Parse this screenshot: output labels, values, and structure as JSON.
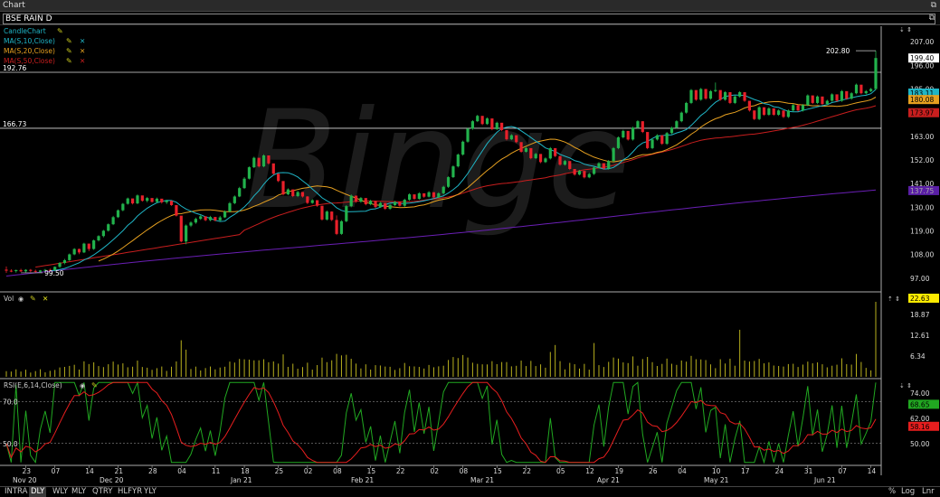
{
  "window": {
    "title": "Chart"
  },
  "symbol": "BSE RAIN D",
  "indicators": {
    "candle": "CandleChart",
    "ma10": "MA(S,10,Close)",
    "ma20": "MA(S,20,Close)",
    "ma50": "MA(S,50,Close)",
    "vol": "Vol",
    "rsi": "RSI(E,6,14,Close)"
  },
  "colors": {
    "up": "#22b24c",
    "down": "#e8202a",
    "ma10": "#1fb5c6",
    "ma20": "#e6a020",
    "ma50": "#c81e1e",
    "ma200": "#6a1fb5",
    "vol": "#b8b01e",
    "rsi": "#21a821",
    "rsisig": "#e61e1e"
  },
  "price_axis": {
    "ticks": [
      "207.00",
      "196.00",
      "185.00",
      "174.00",
      "163.00",
      "152.00",
      "141.00",
      "130.00",
      "119.00",
      "108.00",
      "97.00"
    ]
  },
  "badges": {
    "last": "199.40",
    "ma10": "183.11",
    "ma20": "180.08",
    "ma50": "173.97",
    "ma200": "137.75",
    "vol": "22.63",
    "rsi_a": "68.65",
    "rsi_b": "58.16"
  },
  "annotations": {
    "high": "202.80",
    "low": "99.50",
    "hline1": "192.76",
    "hline2": "166.73"
  },
  "vol_axis": {
    "ticks": [
      "18.87",
      "12.61",
      "6.34"
    ]
  },
  "rsi_axis": {
    "ticks": [
      "74.00",
      "62.00",
      "50.00"
    ],
    "left_70": "70.0",
    "left_50": "50.0"
  },
  "date_axis": {
    "days": [
      "23",
      "07",
      "14",
      "21",
      "28",
      "04",
      "11",
      "18",
      "25",
      "02",
      "08",
      "15",
      "22",
      "02",
      "08",
      "15",
      "22",
      "05",
      "12",
      "19",
      "26",
      "04",
      "10",
      "17",
      "24",
      "31",
      "07",
      "14"
    ],
    "months": [
      "Nov 20",
      "Dec 20",
      "Jan 21",
      "Feb 21",
      "Mar 21",
      "Apr 21",
      "May 21",
      "Jun 21"
    ]
  },
  "periods": [
    "INTRA",
    "DLY",
    "WLY",
    "MLY",
    "QTRY",
    "HLFYR",
    "YLY"
  ],
  "active_period": "DLY",
  "scale_buttons": [
    "%",
    "Log",
    "Lnr"
  ],
  "watermark": "Binge",
  "chart_data": {
    "type": "candlestick",
    "ohlc_approx": [
      [
        101,
        102.5,
        99.5,
        100.5
      ],
      [
        100.5,
        101.2,
        99.8,
        100.3
      ],
      [
        100.3,
        101,
        99.6,
        100.8
      ],
      [
        100.8,
        101.4,
        99.9,
        100.2
      ],
      [
        100.2,
        101.2,
        99.7,
        100.9
      ],
      [
        100.9,
        101.3,
        99.8,
        100.4
      ],
      [
        100.4,
        101,
        99.5,
        100
      ],
      [
        100,
        100.8,
        99.5,
        100.6
      ],
      [
        100.6,
        101.3,
        100.1,
        100.9
      ],
      [
        100.9,
        101.5,
        100.2,
        100.7
      ],
      [
        100.7,
        102.5,
        100.3,
        102.3
      ],
      [
        102.3,
        104.5,
        101.8,
        104.1
      ],
      [
        104.1,
        106,
        103.5,
        105.4
      ],
      [
        105.4,
        108.5,
        105,
        108.1
      ],
      [
        108.1,
        111,
        107.7,
        110.6
      ],
      [
        110.6,
        110.8,
        108.2,
        109
      ],
      [
        109,
        113.5,
        108.7,
        113.1
      ],
      [
        113.1,
        112.8,
        109.6,
        110.6
      ],
      [
        110.6,
        115,
        110.2,
        114.6
      ],
      [
        114.6,
        117,
        114.1,
        116.6
      ],
      [
        116.6,
        119.5,
        116,
        119.1
      ],
      [
        119.1,
        122.5,
        118.7,
        122.1
      ],
      [
        122.1,
        126,
        121.7,
        125.4
      ],
      [
        125.4,
        129,
        125,
        128.6
      ],
      [
        128.6,
        132,
        128.1,
        131.6
      ],
      [
        131.6,
        134.5,
        131.2,
        134.1
      ],
      [
        134.1,
        133.8,
        131.3,
        131.8
      ],
      [
        131.8,
        136,
        131.4,
        135.5
      ],
      [
        135.5,
        135.3,
        132.6,
        133
      ],
      [
        133,
        134.8,
        132.3,
        134.3
      ],
      [
        134.3,
        134.1,
        132.2,
        132.5
      ],
      [
        132.5,
        134.5,
        132,
        134
      ],
      [
        134,
        133.8,
        131.7,
        132.3
      ],
      [
        132.3,
        133.5,
        131.5,
        133
      ],
      [
        133,
        132.8,
        130.6,
        131
      ],
      [
        131,
        130.6,
        125.7,
        126.1
      ],
      [
        126.1,
        125.8,
        113.7,
        114.1
      ],
      [
        114.1,
        122,
        112.8,
        121.5
      ],
      [
        121.5,
        123.5,
        120.8,
        122.9
      ],
      [
        122.9,
        125.2,
        122.3,
        124.6
      ],
      [
        124.6,
        126.5,
        124.1,
        125.8
      ],
      [
        125.8,
        125.5,
        123.5,
        124
      ],
      [
        124,
        126,
        123.5,
        125.5
      ],
      [
        125.5,
        125.3,
        123.4,
        123.9
      ],
      [
        123.9,
        126,
        123.5,
        125.3
      ],
      [
        125.3,
        128.5,
        125,
        128
      ],
      [
        128,
        132.5,
        127.6,
        131.9
      ],
      [
        131.9,
        135.5,
        131.4,
        135
      ],
      [
        135,
        139.5,
        134.7,
        138.9
      ],
      [
        138.9,
        144,
        138.5,
        143.3
      ],
      [
        143.3,
        149,
        142.9,
        148.6
      ],
      [
        148.6,
        153.5,
        148.2,
        153
      ],
      [
        153,
        152.8,
        148.5,
        149
      ],
      [
        149,
        154.6,
        148.6,
        154.1
      ],
      [
        154.1,
        153.6,
        149.9,
        150.4
      ],
      [
        150.4,
        150.2,
        145.1,
        145.6
      ],
      [
        145.6,
        145.4,
        141.7,
        142.2
      ],
      [
        142.2,
        141.9,
        135.5,
        136
      ],
      [
        136,
        138.8,
        135.6,
        138.3
      ],
      [
        138.3,
        138,
        134.7,
        135.2
      ],
      [
        135.2,
        137.6,
        134.7,
        137.1
      ],
      [
        137.1,
        137,
        134.5,
        135
      ],
      [
        135,
        135.2,
        131.5,
        132
      ],
      [
        132,
        133.8,
        131.6,
        133.3
      ],
      [
        133.3,
        133,
        130.2,
        130.7
      ],
      [
        130.7,
        129.9,
        123.8,
        124.3
      ],
      [
        124.3,
        128.5,
        123.8,
        128
      ],
      [
        128,
        128.1,
        123.6,
        124.1
      ],
      [
        124.1,
        126.2,
        117.1,
        117.6
      ],
      [
        117.6,
        124,
        117.2,
        123.5
      ],
      [
        123.5,
        131,
        123,
        130.5
      ],
      [
        130.5,
        136,
        130,
        135.4
      ],
      [
        135.4,
        135.2,
        132.1,
        132.6
      ],
      [
        132.6,
        134.8,
        132.1,
        134.3
      ],
      [
        134.3,
        133.9,
        130.9,
        131.4
      ],
      [
        131.4,
        133.5,
        130.9,
        133
      ],
      [
        133,
        132.6,
        129.6,
        130.1
      ],
      [
        130.1,
        132.5,
        129.7,
        132
      ],
      [
        132,
        131.6,
        128.8,
        129.3
      ],
      [
        129.3,
        131.5,
        128.8,
        131
      ],
      [
        131,
        133,
        130.6,
        132.5
      ],
      [
        132.5,
        132.2,
        130.3,
        130.7
      ],
      [
        130.7,
        134,
        130.2,
        133.5
      ],
      [
        133.5,
        136.5,
        133,
        136
      ],
      [
        136,
        135.7,
        133.4,
        133.9
      ],
      [
        133.9,
        137,
        133.5,
        136.5
      ],
      [
        136.5,
        136.3,
        134.4,
        134.9
      ],
      [
        134.9,
        137.5,
        134.5,
        137
      ],
      [
        137,
        136.7,
        134.1,
        134.6
      ],
      [
        134.6,
        137,
        134.2,
        136.5
      ],
      [
        136.5,
        140,
        136,
        139.5
      ],
      [
        139.5,
        144.5,
        139,
        144
      ],
      [
        144,
        149.5,
        143.6,
        149
      ],
      [
        149,
        155,
        148.5,
        154.5
      ],
      [
        154.5,
        161,
        154,
        160.5
      ],
      [
        160.5,
        167,
        160,
        166.5
      ],
      [
        166.5,
        170.5,
        166,
        170
      ],
      [
        170,
        173,
        169.6,
        172.5
      ],
      [
        172.5,
        171.2,
        168.2,
        168.7
      ],
      [
        168.7,
        171.8,
        168.3,
        171.3
      ],
      [
        171.3,
        170.8,
        165.8,
        166.3
      ],
      [
        166.3,
        169.8,
        165.9,
        169.3
      ],
      [
        169.3,
        169,
        165.4,
        165.9
      ],
      [
        165.9,
        165.6,
        161.1,
        161.6
      ],
      [
        161.6,
        164,
        161.2,
        163.5
      ],
      [
        163.5,
        163.3,
        159.8,
        160.3
      ],
      [
        160.3,
        160.1,
        155.3,
        155.8
      ],
      [
        155.8,
        158,
        155.4,
        157.5
      ],
      [
        157.5,
        157.3,
        152.3,
        152.8
      ],
      [
        152.8,
        155.3,
        152.4,
        154.8
      ],
      [
        154.8,
        154.4,
        150.5,
        151
      ],
      [
        151,
        153.2,
        150.6,
        152.7
      ],
      [
        152.7,
        158,
        152.2,
        157.5
      ],
      [
        157.5,
        157.4,
        153.3,
        153.8
      ],
      [
        153.8,
        153.6,
        149.3,
        149.8
      ],
      [
        149.8,
        152,
        149.4,
        151.5
      ],
      [
        151.5,
        151.2,
        147.3,
        147.8
      ],
      [
        147.8,
        147.5,
        144.7,
        145.2
      ],
      [
        145.2,
        147.4,
        144.8,
        146.9
      ],
      [
        146.9,
        146.7,
        143.4,
        143.9
      ],
      [
        143.9,
        146,
        143.5,
        145.5
      ],
      [
        145.5,
        149,
        145,
        148.5
      ],
      [
        148.5,
        151,
        148,
        150.5
      ],
      [
        150.5,
        150.2,
        147.5,
        148
      ],
      [
        148,
        152,
        147.5,
        151.5
      ],
      [
        151.5,
        158,
        151,
        157.5
      ],
      [
        157.5,
        163,
        157,
        162.5
      ],
      [
        162.5,
        166,
        162,
        165.5
      ],
      [
        165.5,
        165,
        161,
        161.5
      ],
      [
        161.5,
        167.5,
        161,
        167
      ],
      [
        167,
        170.5,
        166.5,
        170
      ],
      [
        170,
        170,
        164.5,
        165
      ],
      [
        165,
        158,
        157,
        157.5
      ],
      [
        157.5,
        162,
        157,
        161.5
      ],
      [
        161.5,
        164,
        161,
        163.5
      ],
      [
        163.5,
        163,
        159,
        159.5
      ],
      [
        159.5,
        165,
        159,
        164.5
      ],
      [
        164.5,
        167.5,
        164,
        167
      ],
      [
        167,
        170.5,
        166.5,
        170
      ],
      [
        170,
        174.5,
        169.5,
        174
      ],
      [
        174,
        179,
        173.5,
        178.5
      ],
      [
        178.5,
        185,
        178,
        184.5
      ],
      [
        184.5,
        184,
        179.5,
        180
      ],
      [
        180,
        185.5,
        179.5,
        185
      ],
      [
        185,
        184.5,
        180,
        180.5
      ],
      [
        180.5,
        184.5,
        180,
        184
      ],
      [
        184,
        188,
        183.5,
        184.5
      ],
      [
        184.5,
        184,
        179.5,
        180
      ],
      [
        180,
        184,
        179.5,
        183.5
      ],
      [
        183.5,
        183,
        178,
        178.5
      ],
      [
        178.5,
        182,
        178,
        181.5
      ],
      [
        181.5,
        184,
        181,
        183.5
      ],
      [
        183.5,
        183,
        179,
        179.5
      ],
      [
        179.5,
        179.2,
        174.5,
        175
      ],
      [
        175,
        175,
        170.5,
        171
      ],
      [
        171,
        177,
        170.5,
        176.5
      ],
      [
        176.5,
        176.3,
        172.5,
        173
      ],
      [
        173,
        176.5,
        172.5,
        176
      ],
      [
        176,
        175.8,
        172.5,
        173
      ],
      [
        173,
        175.5,
        172.5,
        175
      ],
      [
        175,
        174.6,
        171.5,
        172
      ],
      [
        172,
        175.5,
        171.5,
        175
      ],
      [
        175,
        178,
        174.5,
        177.5
      ],
      [
        177.5,
        177.2,
        174.5,
        175
      ],
      [
        175,
        178,
        174.5,
        177.5
      ],
      [
        177.5,
        182.5,
        177,
        182
      ],
      [
        182,
        181.8,
        178,
        178.5
      ],
      [
        178.5,
        182,
        178,
        181.5
      ],
      [
        181.5,
        181.2,
        177.5,
        178
      ],
      [
        178,
        180,
        177.5,
        179.5
      ],
      [
        179.5,
        183,
        179,
        182.5
      ],
      [
        182.5,
        182.3,
        179,
        179.5
      ],
      [
        179.5,
        184.5,
        179,
        184
      ],
      [
        184,
        183.8,
        180,
        180.5
      ],
      [
        180.5,
        183.5,
        180,
        183
      ],
      [
        183,
        187.5,
        182.5,
        187
      ],
      [
        187,
        186.8,
        182.5,
        183
      ],
      [
        183,
        184.5,
        182.5,
        184
      ],
      [
        184,
        185.5,
        183.5,
        185
      ],
      [
        185,
        202.8,
        184.5,
        199.4
      ]
    ]
  }
}
